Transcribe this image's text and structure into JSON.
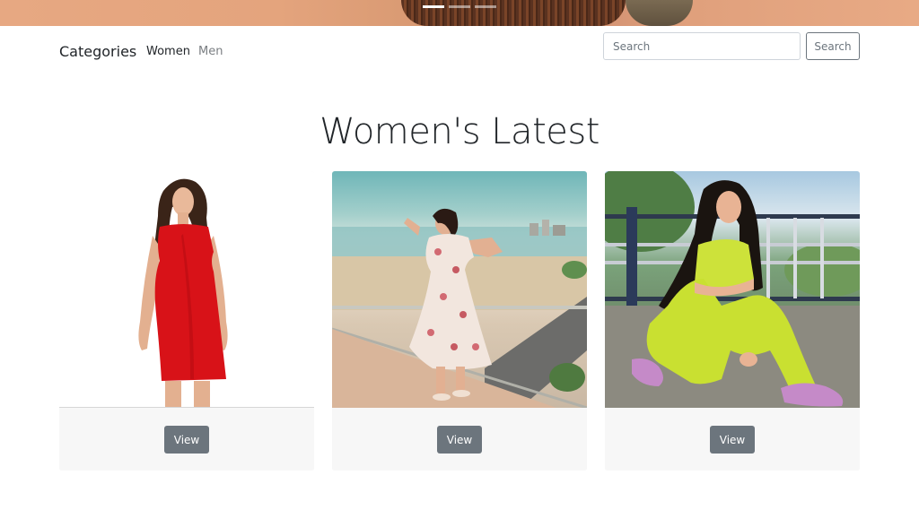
{
  "carousel": {
    "indicators": [
      {
        "active": true
      },
      {
        "active": false
      },
      {
        "active": false
      }
    ]
  },
  "navbar": {
    "brand": "Categories",
    "links": [
      {
        "label": "Women",
        "active": true
      },
      {
        "label": "Men",
        "active": false
      }
    ],
    "search": {
      "placeholder": "Search",
      "value": "",
      "button_label": "Search"
    }
  },
  "main": {
    "title": "Women's Latest",
    "products": [
      {
        "image": "woman-red-dress-photo",
        "button_label": "View"
      },
      {
        "image": "woman-floral-dress-photo",
        "button_label": "View"
      },
      {
        "image": "woman-lime-outfit-photo",
        "button_label": "View"
      }
    ]
  },
  "colors": {
    "button_secondary": "#6c757d",
    "card_footer": "#f7f7f7",
    "text": "#212529"
  }
}
